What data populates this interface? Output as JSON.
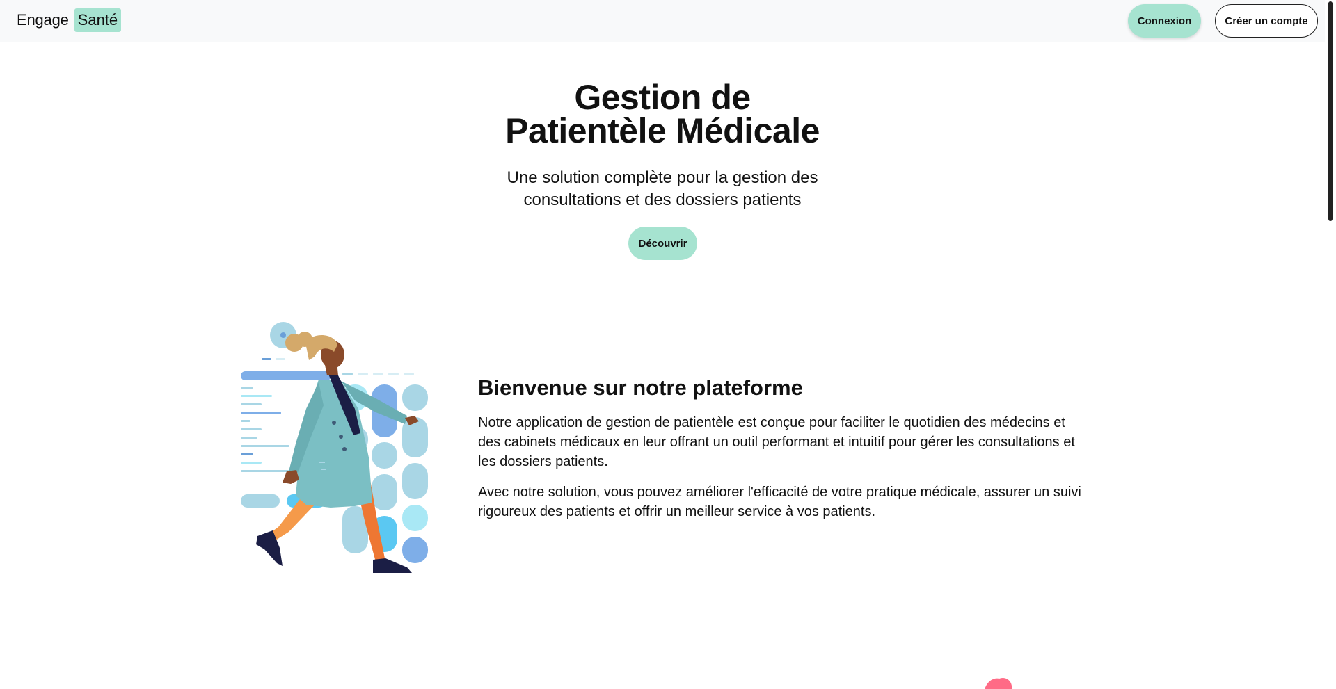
{
  "navbar": {
    "brand_word": "Engage",
    "brand_accent": "Santé",
    "login_label": "Connexion",
    "signup_label": "Créer un compte"
  },
  "hero": {
    "title_line1": "Gestion de",
    "title_line2": "Patientèle Médicale",
    "subtitle_line1": "Une solution complète pour la gestion des",
    "subtitle_line2": "consultations et des dossiers patients",
    "cta_label": "Découvrir"
  },
  "welcome": {
    "title": "Bienvenue sur notre plateforme",
    "paragraph1": "Notre application de gestion de patientèle est conçue pour faciliter le quotidien des médecins et des cabinets médicaux en leur offrant un outil performant et intuitif pour gérer les consultations et les dossiers patients.",
    "paragraph2": "Avec notre solution, vous pouvez améliorer l'efficacité de votre pratique médicale, assurer un suivi rigoureux des patients et offrir un meilleur service à vos patients."
  },
  "colors": {
    "accent": "#a6e3d0",
    "navbar_bg": "#f8f9fa",
    "text": "#111111",
    "coat": "#7bbfc4",
    "pants": "#ee7733",
    "blob": "#ff6b86"
  },
  "icons": {
    "illustration": "doctor-walking-illustration",
    "decor": "pink-blob-decoration"
  }
}
